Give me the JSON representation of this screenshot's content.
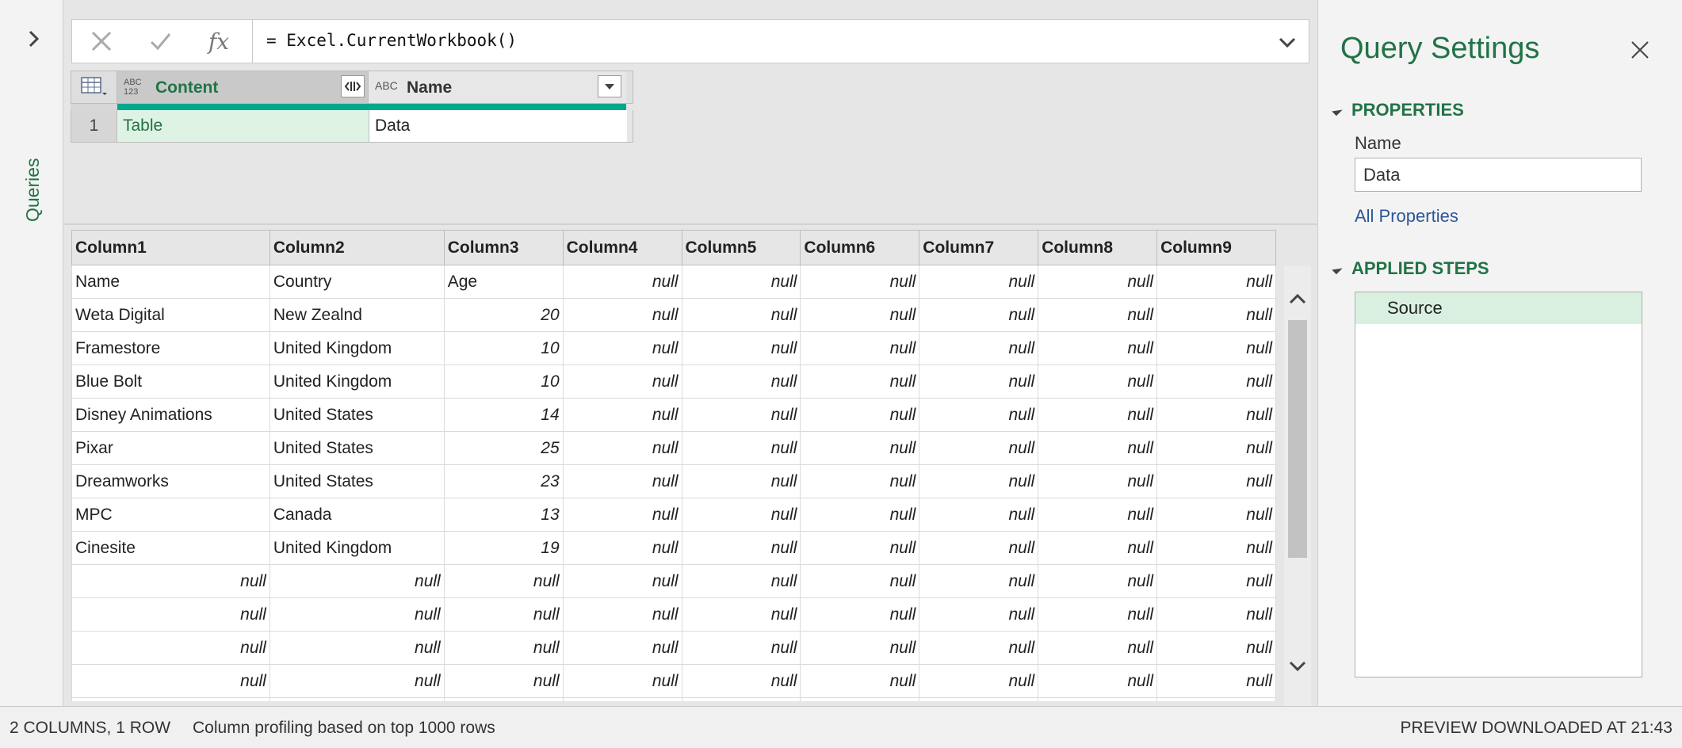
{
  "queries_pane": {
    "label": "Queries"
  },
  "formula": {
    "cancel_icon": "close-x-icon",
    "commit_icon": "checkmark-icon",
    "fx_label": "fx",
    "text": "= Excel.CurrentWorkbook()"
  },
  "nav_table": {
    "columns": [
      {
        "type_label": "ABC 123",
        "name": "Content"
      },
      {
        "type_label": "ABC",
        "name": "Name"
      }
    ],
    "row": {
      "index": "1",
      "content": "Table",
      "name": "Data"
    }
  },
  "preview": {
    "columns": [
      "Column1",
      "Column2",
      "Column3",
      "Column4",
      "Column5",
      "Column6",
      "Column7",
      "Column8",
      "Column9"
    ],
    "rows": [
      [
        "Name",
        "Country",
        "Age",
        "null",
        "null",
        "null",
        "null",
        "null",
        "null"
      ],
      [
        "Weta Digital",
        "New Zealnd",
        "20",
        "null",
        "null",
        "null",
        "null",
        "null",
        "null"
      ],
      [
        "Framestore",
        "United Kingdom",
        "10",
        "null",
        "null",
        "null",
        "null",
        "null",
        "null"
      ],
      [
        "Blue Bolt",
        "United Kingdom",
        "10",
        "null",
        "null",
        "null",
        "null",
        "null",
        "null"
      ],
      [
        "Disney Animations",
        "United States",
        "14",
        "null",
        "null",
        "null",
        "null",
        "null",
        "null"
      ],
      [
        "Pixar",
        "United States",
        "25",
        "null",
        "null",
        "null",
        "null",
        "null",
        "null"
      ],
      [
        "Dreamworks",
        "United States",
        "23",
        "null",
        "null",
        "null",
        "null",
        "null",
        "null"
      ],
      [
        "MPC",
        "Canada",
        "13",
        "null",
        "null",
        "null",
        "null",
        "null",
        "null"
      ],
      [
        "Cinesite",
        "United Kingdom",
        "19",
        "null",
        "null",
        "null",
        "null",
        "null",
        "null"
      ],
      [
        "null",
        "null",
        "null",
        "null",
        "null",
        "null",
        "null",
        "null",
        "null"
      ],
      [
        "null",
        "null",
        "null",
        "null",
        "null",
        "null",
        "null",
        "null",
        "null"
      ],
      [
        "null",
        "null",
        "null",
        "null",
        "null",
        "null",
        "null",
        "null",
        "null"
      ],
      [
        "null",
        "null",
        "null",
        "null",
        "null",
        "null",
        "null",
        "null",
        "null"
      ],
      [
        "null",
        "null",
        "null",
        "null",
        "null",
        "null",
        "null",
        "null",
        "null"
      ]
    ]
  },
  "settings": {
    "title": "Query Settings",
    "properties_header": "PROPERTIES",
    "name_label": "Name",
    "name_value": "Data",
    "all_properties": "All Properties",
    "applied_steps_header": "APPLIED STEPS",
    "steps": [
      "Source"
    ]
  },
  "status": {
    "columns_rows": "2 COLUMNS, 1 ROW",
    "profiling": "Column profiling based on top 1000 rows",
    "preview": "PREVIEW DOWNLOADED AT 21:43"
  },
  "colors": {
    "accent": "#217346",
    "teal": "#00a88c",
    "link": "#2b5797"
  }
}
